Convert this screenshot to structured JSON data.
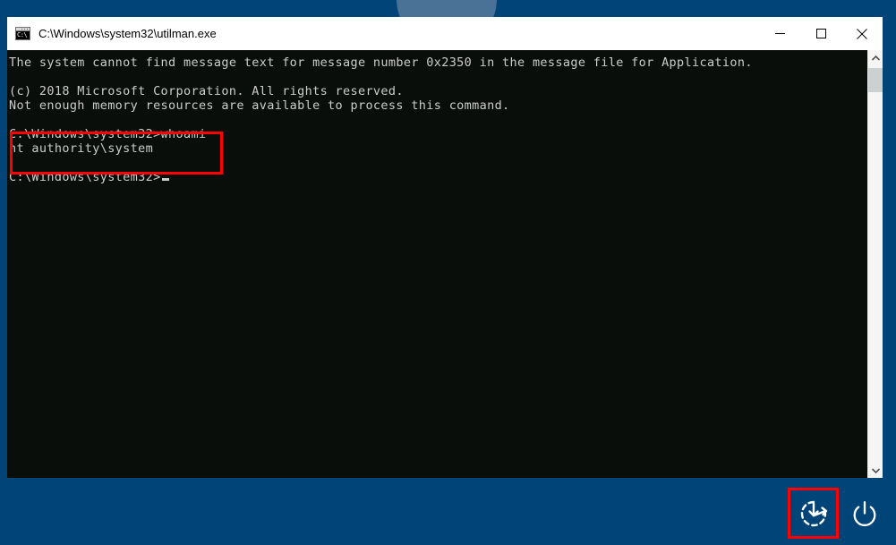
{
  "screen": {
    "background_color": "#014478",
    "avatar_color": "#4a7296",
    "highlight_color": "#ff0000"
  },
  "console_window": {
    "title": "C:\\Windows\\system32\\utilman.exe",
    "icon": "cmd-console-icon",
    "icon_text": "C:\\",
    "background_color": "#0a0e0a",
    "text_color": "#cccccc",
    "controls": [
      {
        "name": "minimize",
        "label": "—"
      },
      {
        "name": "maximize",
        "label": "□"
      },
      {
        "name": "close",
        "label": "✕"
      }
    ],
    "lines": [
      "The system cannot find message text for message number 0x2350 in the message file for Application.",
      "",
      "(c) 2018 Microsoft Corporation. All rights reserved.",
      "Not enough memory resources are available to process this command.",
      "",
      "C:\\Windows\\system32>whoami",
      "nt authority\\system",
      "",
      "C:\\Windows\\system32>"
    ],
    "highlighted_command": "whoami",
    "highlighted_output": "nt authority\\system",
    "prompt": "C:\\Windows\\system32>",
    "scrollbar": {
      "up_arrow": "chevron-up-icon",
      "down_arrow": "chevron-down-icon"
    }
  },
  "corner_buttons": [
    {
      "name": "ease-of-access-button",
      "icon": "ease-of-access-icon",
      "label": "Ease of Access",
      "highlighted": true
    },
    {
      "name": "power-button",
      "icon": "power-icon",
      "label": "Power",
      "highlighted": false
    }
  ]
}
